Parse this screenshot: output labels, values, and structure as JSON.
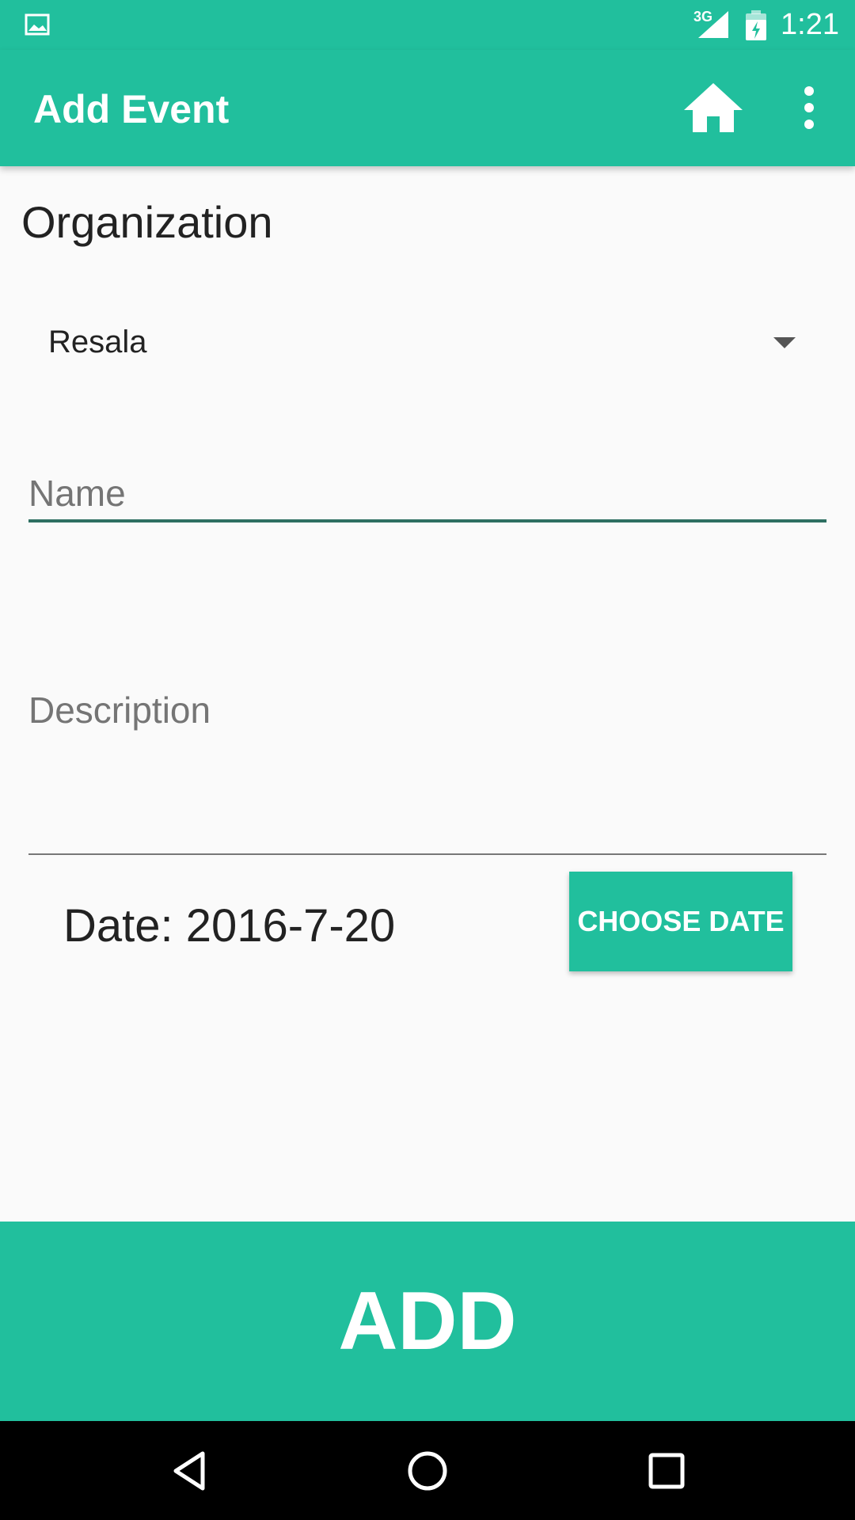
{
  "status_bar": {
    "network": "3G",
    "time": "1:21"
  },
  "app_bar": {
    "title": "Add Event",
    "icons": [
      "home-icon",
      "more-vert-icon"
    ]
  },
  "form": {
    "organization_label": "Organization",
    "organization_selected": "Resala",
    "name_placeholder": "Name",
    "name_value": "",
    "description_placeholder": "Description",
    "description_value": "",
    "date_label": "Date: 2016-7-20",
    "choose_date_label": "CHOOSE DATE"
  },
  "actions": {
    "add_label": "ADD"
  },
  "colors": {
    "primary": "#21BF9D",
    "accent_underline": "#2E6F62",
    "background": "#FAFAFA"
  }
}
